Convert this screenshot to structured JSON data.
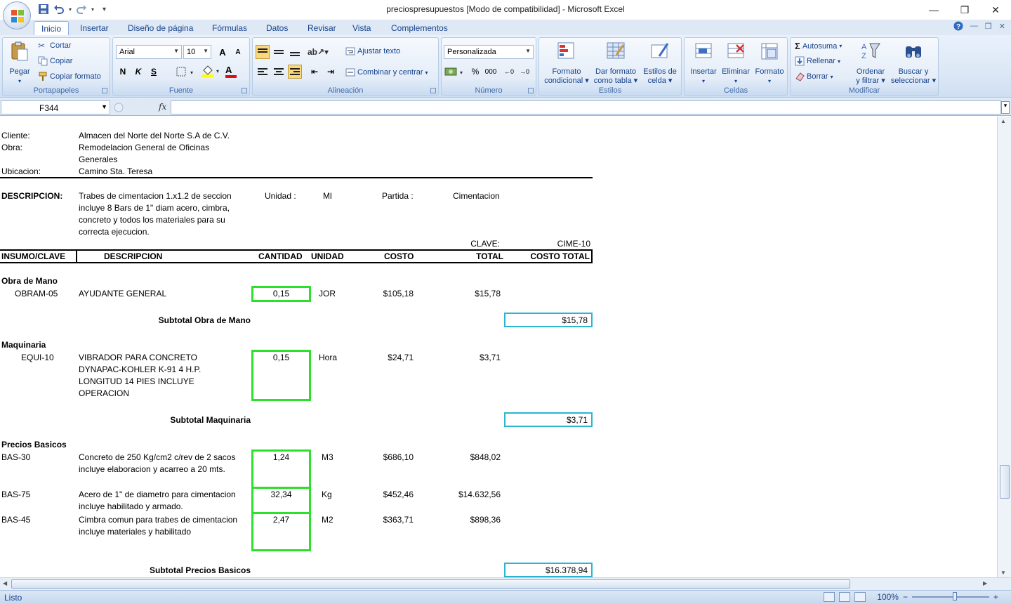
{
  "window": {
    "title": "preciospresupuestos  [Modo de compatibilidad] - Microsoft Excel",
    "minimize": "—",
    "restore": "❐",
    "close": "✕"
  },
  "tabs": [
    "Inicio",
    "Insertar",
    "Diseño de página",
    "Fórmulas",
    "Datos",
    "Revisar",
    "Vista",
    "Complementos"
  ],
  "ribbon": {
    "portapapeles": {
      "label": "Portapapeles",
      "pegar": "Pegar",
      "cortar": "Cortar",
      "copiar": "Copiar",
      "copiar_formato": "Copiar formato"
    },
    "fuente": {
      "label": "Fuente",
      "font": "Arial",
      "size": "10",
      "grow": "A",
      "shrink": "A",
      "bold": "N",
      "italic": "K",
      "underline": "S",
      "font_color_letter": "A"
    },
    "alineacion": {
      "label": "Alineación",
      "ajustar": "Ajustar texto",
      "combinar": "Combinar y centrar"
    },
    "numero": {
      "label": "Número",
      "format": "Personalizada",
      "percent": "%",
      "thousands": "000",
      "inc_dec": ",0→,00",
      "dec_dec": ",00→,0"
    },
    "estilos": {
      "label": "Estilos",
      "formato_cond_1": "Formato",
      "formato_cond_2": "condicional",
      "dar_formato_1": "Dar formato",
      "dar_formato_2": "como tabla",
      "estilos_celda_1": "Estilos de",
      "estilos_celda_2": "celda"
    },
    "celdas": {
      "label": "Celdas",
      "insertar": "Insertar",
      "eliminar": "Eliminar",
      "formato": "Formato"
    },
    "modificar": {
      "label": "Modificar",
      "autosuma": "Autosuma",
      "rellenar": "Rellenar",
      "borrar": "Borrar",
      "ordenar_1": "Ordenar",
      "ordenar_2": "y filtrar",
      "buscar_1": "Buscar y",
      "buscar_2": "seleccionar",
      "sigma": "Σ"
    }
  },
  "formula_bar": {
    "name_box": "F344",
    "fx": "fx",
    "content": ""
  },
  "sheet": {
    "cliente_label": "Cliente:",
    "cliente": "Almacen del Norte del Norte S.A de C.V.",
    "obra_label": "Obra:",
    "obra_1": "Remodelacion General de Oficinas",
    "obra_2": "Generales",
    "ubicacion_label": "Ubicacion:",
    "ubicacion": "Camino Sta. Teresa",
    "descripcion_label": "DESCRIPCION:",
    "descripcion_lines": [
      "Trabes de cimentacion 1.x1.2 de seccion",
      "incluye 8 Bars de 1\" diam acero,  cimbra,",
      "concreto y todos los materiales para su",
      "correcta ejecucion."
    ],
    "unidad_label": "Unidad :",
    "unidad": "Ml",
    "partida_label": "Partida :",
    "partida": "Cimentacion",
    "clave_label": "CLAVE:",
    "clave": "CIME-10",
    "headers": [
      "INSUMO/CLAVE",
      "DESCRIPCION",
      "CANTIDAD",
      "UNIDAD",
      "COSTO",
      "TOTAL",
      "COSTO TOTAL"
    ],
    "obra_mano": {
      "title": "Obra de Mano",
      "rows": [
        {
          "clave": "OBRAM-05",
          "desc": [
            "AYUDANTE GENERAL"
          ],
          "cantidad": "0,15",
          "unidad": "JOR",
          "costo": "$105,18",
          "total": "$15,78"
        }
      ],
      "subtotal_label": "Subtotal Obra de Mano",
      "subtotal": "$15,78"
    },
    "maquinaria": {
      "title": "Maquinaria",
      "rows": [
        {
          "clave": "EQUI-10",
          "desc": [
            "VIBRADOR PARA CONCRETO",
            "DYNAPAC-KOHLER K-91 4 H.P.",
            "LONGITUD 14 PIES INCLUYE",
            "OPERACION"
          ],
          "cantidad": "0,15",
          "unidad": "Hora",
          "costo": "$24,71",
          "total": "$3,71"
        }
      ],
      "subtotal_label": "Subtotal Maquinaria",
      "subtotal": "$3,71"
    },
    "precios_basicos": {
      "title": "Precios Basicos",
      "rows": [
        {
          "clave": "BAS-30",
          "desc": [
            "Concreto de 250 Kg/cm2 c/rev de 2 sacos",
            "incluye elaboracion y acarreo a 20 mts."
          ],
          "cantidad": "1,24",
          "unidad": "M3",
          "costo": "$686,10",
          "total": "$848,02"
        },
        {
          "clave": "BAS-75",
          "desc": [
            "Acero de 1\" de diametro para cimentacion",
            "incluye habilitado y armado."
          ],
          "cantidad": "32,34",
          "unidad": "Kg",
          "costo": "$452,46",
          "total": "$14.632,56"
        },
        {
          "clave": "BAS-45",
          "desc": [
            "Cimbra comun para trabes de cimentacion",
            "incluye materiales y habilitado"
          ],
          "cantidad": "2,47",
          "unidad": "M2",
          "costo": "$363,71",
          "total": "$898,36"
        }
      ],
      "subtotal_label": "Subtotal Precios Basicos",
      "subtotal": "$16.378,94"
    }
  },
  "status": {
    "text": "Listo",
    "zoom": "100%",
    "minus": "−",
    "plus": "+"
  },
  "colors": {
    "ribbon": "#dce8f6",
    "accent": "#15428b",
    "green_box": "#2ee02e",
    "cyan_box": "#2bb5d1"
  }
}
